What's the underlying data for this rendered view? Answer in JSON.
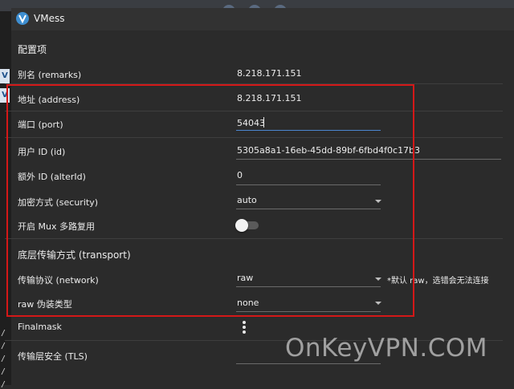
{
  "window": {
    "title": "VMess"
  },
  "form": {
    "section_config": "配置项",
    "remarks": {
      "label": "别名 (remarks)",
      "value": "8.218.171.151"
    },
    "address": {
      "label": "地址 (address)",
      "value": "8.218.171.151"
    },
    "port": {
      "label": "端口 (port)",
      "value": "54043"
    },
    "user_id": {
      "label": "用户 ID (id)",
      "value": "5305a8a1-16eb-45dd-89bf-6fbd4f0c17b3"
    },
    "alter_id": {
      "label": "额外 ID (alterId)",
      "value": "0"
    },
    "security": {
      "label": "加密方式 (security)",
      "value": "auto"
    },
    "mux": {
      "label": "开启 Mux 多路复用",
      "enabled": false
    },
    "section_transport": "底层传输方式 (transport)",
    "network": {
      "label": "传输协议 (network)",
      "value": "raw",
      "hint": "*默认 raw，选错会无法连接"
    },
    "header_type": {
      "label": "raw 伪装类型",
      "value": "none"
    },
    "finalmask": {
      "label": "Finalmask"
    },
    "tls": {
      "label": "传输层安全 (TLS)"
    }
  },
  "watermark": "OnKeyVPN.COM",
  "colors": {
    "highlight": "#d41818",
    "accent": "#4c87d0",
    "background": "#2b2b2b"
  }
}
